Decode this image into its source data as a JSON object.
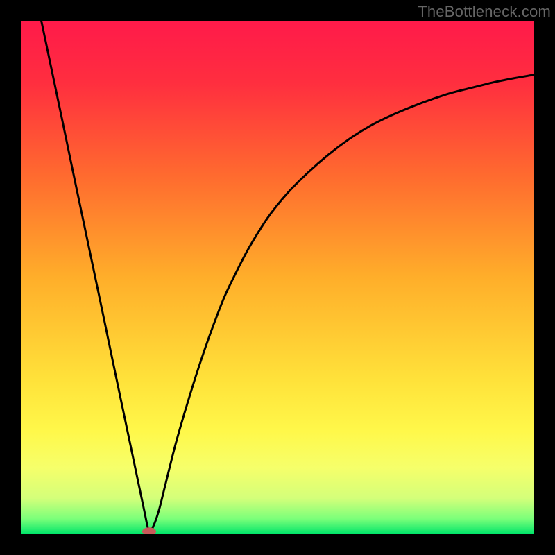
{
  "watermark": "TheBottleneck.com",
  "chart_data": {
    "type": "line",
    "title": "",
    "xlabel": "",
    "ylabel": "",
    "xlim": [
      0,
      100
    ],
    "ylim": [
      0,
      100
    ],
    "grid": false,
    "legend": false,
    "gradient_stops": [
      {
        "pos": 0.0,
        "color": "#ff1a4a"
      },
      {
        "pos": 0.12,
        "color": "#ff2e3f"
      },
      {
        "pos": 0.3,
        "color": "#ff6a2f"
      },
      {
        "pos": 0.5,
        "color": "#ffae2a"
      },
      {
        "pos": 0.7,
        "color": "#ffe23a"
      },
      {
        "pos": 0.8,
        "color": "#fff84a"
      },
      {
        "pos": 0.87,
        "color": "#f6ff6a"
      },
      {
        "pos": 0.93,
        "color": "#d4ff7a"
      },
      {
        "pos": 0.97,
        "color": "#7bff7a"
      },
      {
        "pos": 1.0,
        "color": "#00e56a"
      }
    ],
    "series": [
      {
        "name": "bottleneck-curve",
        "path_alias": "V-shaped bottleneck curve: steep linear descent from top-left (x≈4,y≈100) to near-zero at x≈25, then asymptotic rise toward y≈90 at x=100",
        "x": [
          4.0,
          6.0,
          8.0,
          10.0,
          12.0,
          14.0,
          16.0,
          18.0,
          20.0,
          22.0,
          24.0,
          25.0,
          26.0,
          27.0,
          28.0,
          30.0,
          32.0,
          34.0,
          36.0,
          38.0,
          40.0,
          44.0,
          48.0,
          52.0,
          56.0,
          60.0,
          64.0,
          68.0,
          72.0,
          76.0,
          80.0,
          84.0,
          88.0,
          92.0,
          96.0,
          100.0
        ],
        "y": [
          100.0,
          90.5,
          81.0,
          71.4,
          61.9,
          52.4,
          42.9,
          33.3,
          23.8,
          14.3,
          4.8,
          0.5,
          2.0,
          5.0,
          9.0,
          17.0,
          24.0,
          30.5,
          36.5,
          42.0,
          47.0,
          55.0,
          61.5,
          66.5,
          70.5,
          74.0,
          77.0,
          79.5,
          81.5,
          83.2,
          84.7,
          86.0,
          87.0,
          88.0,
          88.8,
          89.5
        ]
      }
    ],
    "marker": {
      "name": "optimum-point",
      "x": 25.0,
      "y": 0.5,
      "color": "#c85a5a",
      "rx": 10,
      "ry": 6
    }
  }
}
